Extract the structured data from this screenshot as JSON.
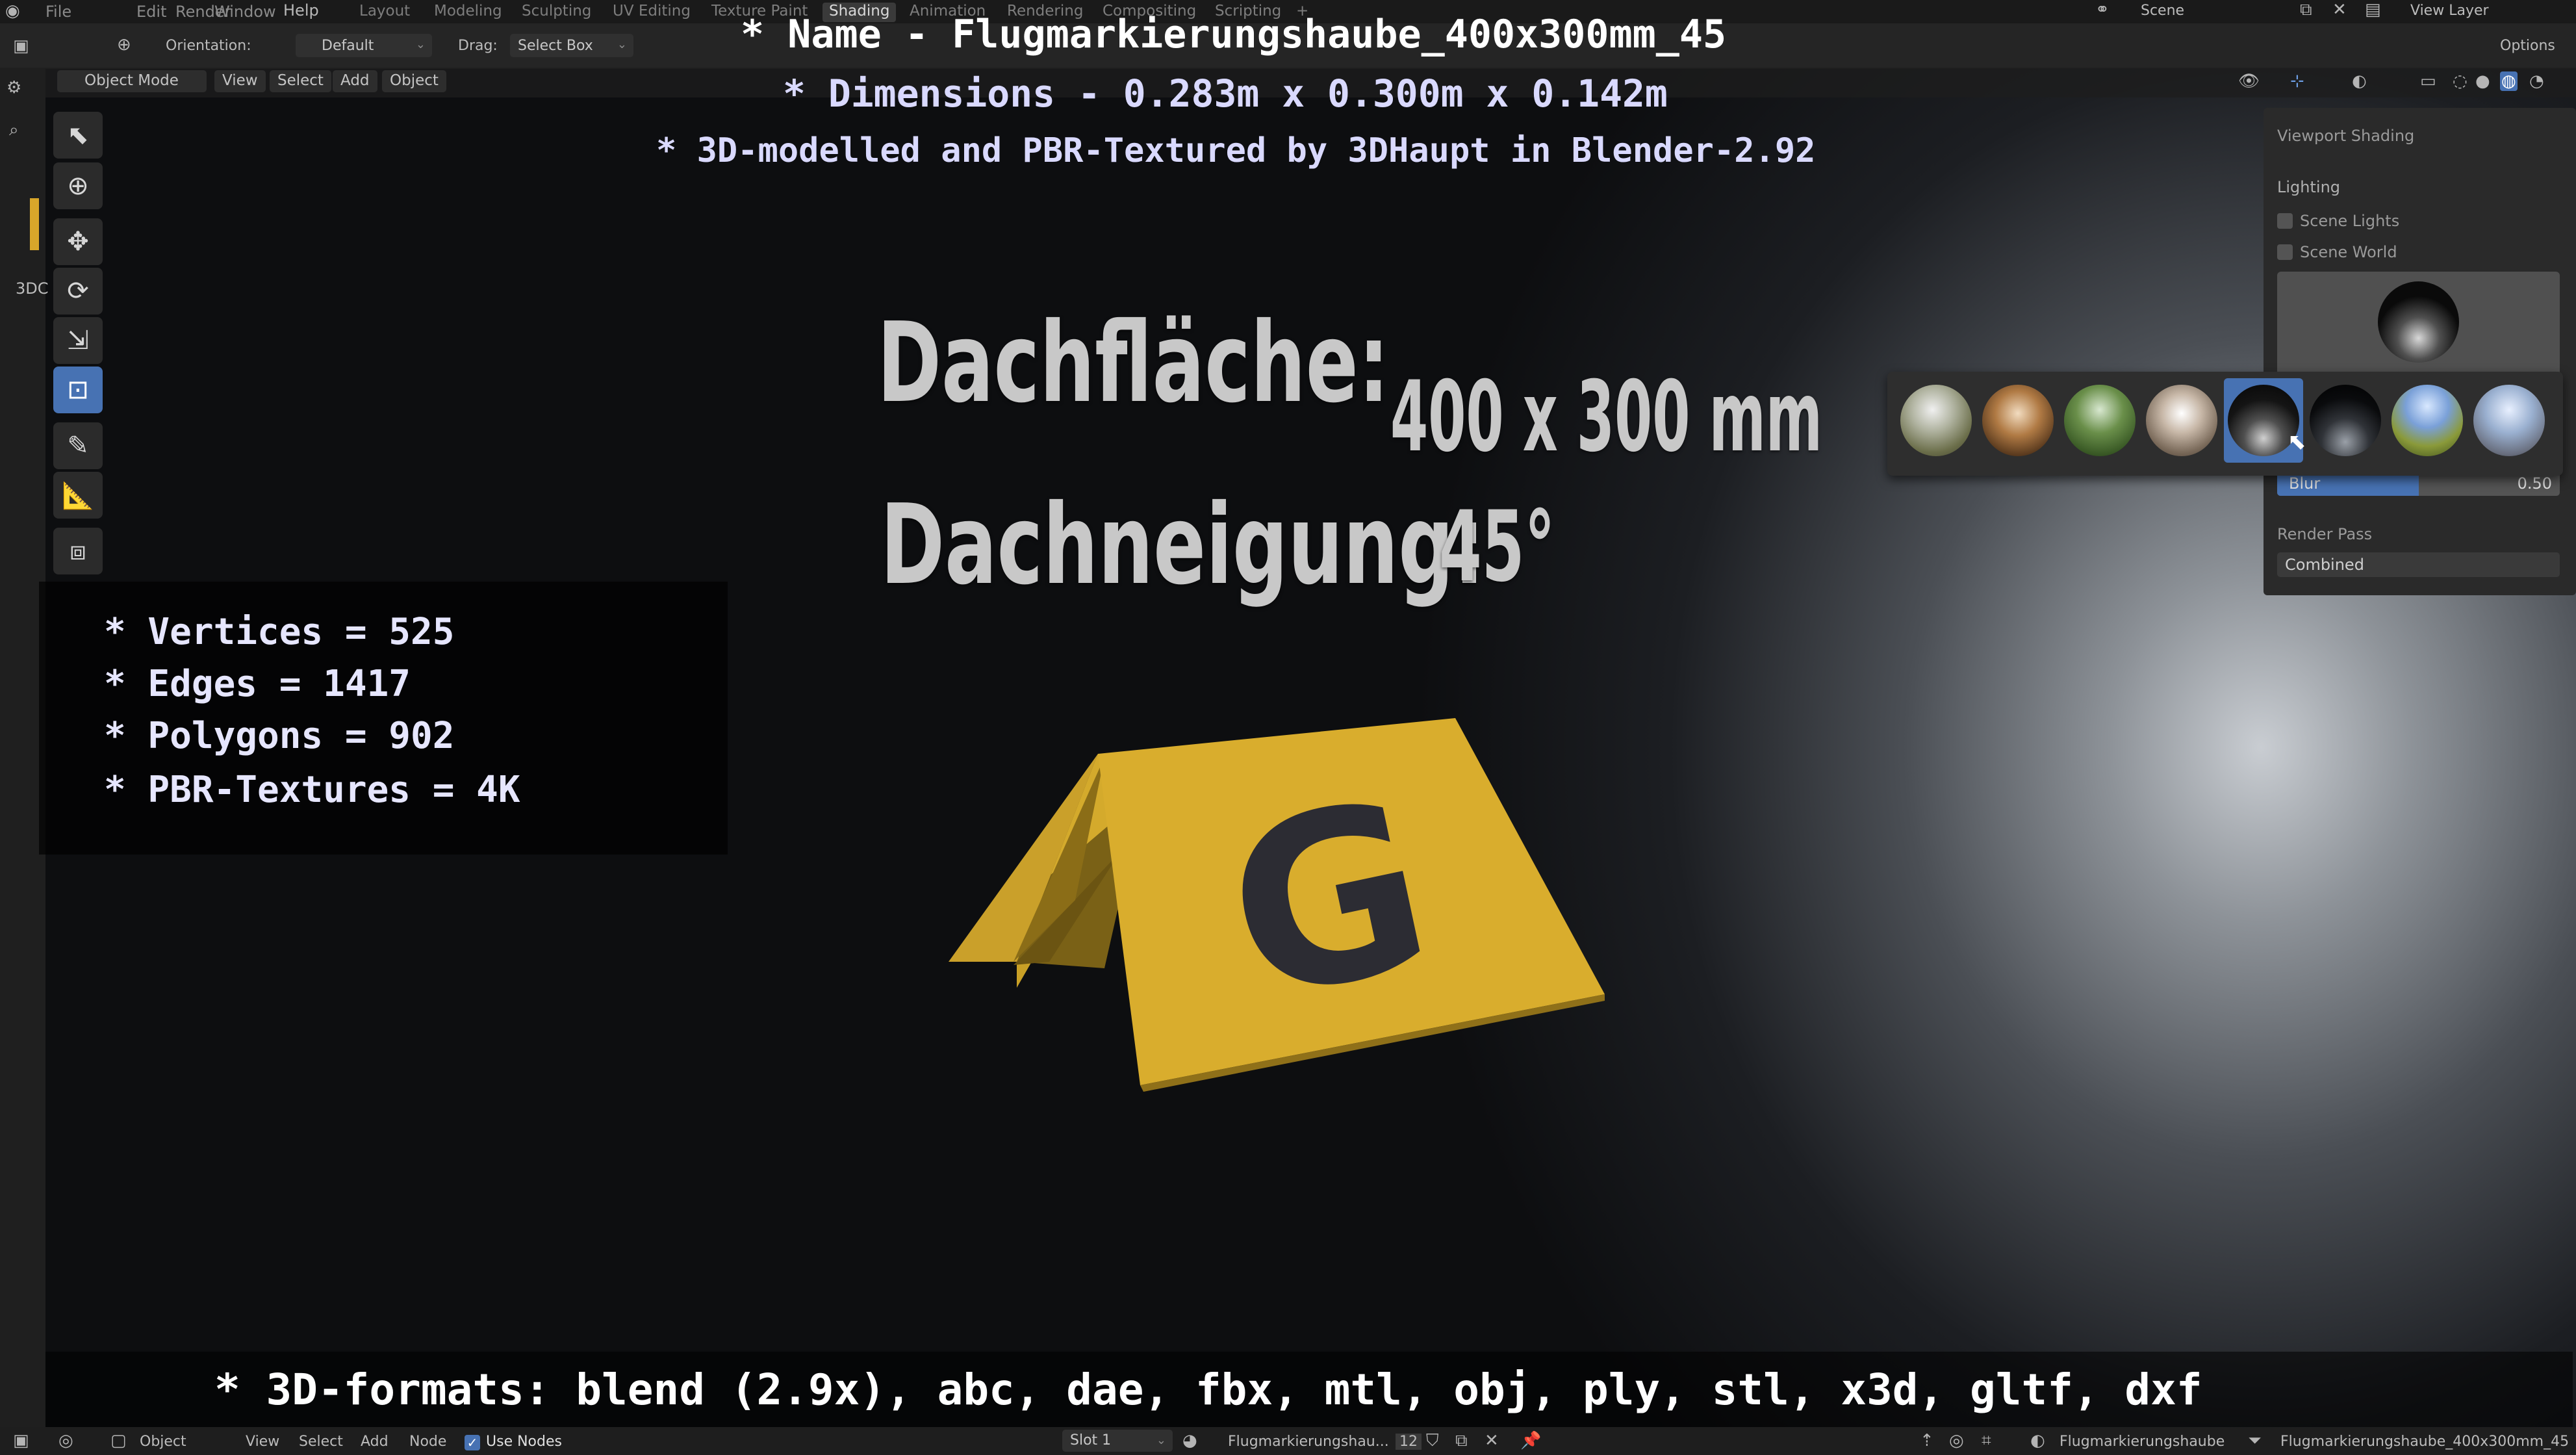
{
  "overlay": {
    "name_line": "* Name - Flugmarkierungshaube_400x300mm_45",
    "dimensions_line": "* Dimensions -  0.283m x 0.300m x 0.142m",
    "credit_line": "* 3D-modelled and PBR-Textured by 3DHaupt in Blender-2.92",
    "stats": [
      "* Vertices = 525",
      "* Edges = 1417",
      "* Polygons = 902",
      "* PBR-Textures = 4K"
    ],
    "formats_line": "* 3D-formats: blend (2.9x), abc, dae, fbx, mtl, obj, ply, stl, x3d, gltf, dxf"
  },
  "scene_text": {
    "roof_area": "Dachfläche:",
    "roof_area_value": "400 x 300 mm",
    "roof_pitch": "Dachneigung:",
    "roof_pitch_value": "45°",
    "marker_letter": "G"
  },
  "topbar": {
    "menu": [
      "File",
      "Edit",
      "Render",
      "Window",
      "Help"
    ],
    "workspaces": [
      "Layout",
      "Modeling",
      "Sculpting",
      "UV Editing",
      "Texture Paint",
      "Shading",
      "Animation",
      "Rendering",
      "Compositing",
      "Scripting",
      "+"
    ],
    "active_workspace": "Shading",
    "scene_label": "Scene",
    "view_layer_label": "View Layer"
  },
  "tool_header": {
    "orientation_label": "Orientation:",
    "orientation_value": "Default",
    "drag_label": "Drag:",
    "drag_value": "Select Box",
    "options_label": "Options"
  },
  "viewport_header": {
    "mode": "Object Mode",
    "menus": [
      "View",
      "Select",
      "Add",
      "Object"
    ]
  },
  "editor_label": "3DC",
  "viewport_shading_panel": {
    "title": "Viewport Shading",
    "lighting_label": "Lighting",
    "scene_lights_label": "Scene Lights",
    "scene_world_label": "Scene World",
    "blur_label": "Blur",
    "blur_value": "0.50",
    "blur_fraction": 0.5,
    "render_pass_label": "Render Pass",
    "render_pass_value": "Combined"
  },
  "hdri_popup": {
    "count": 8,
    "selected_index": 4
  },
  "status_bar": {
    "object_label": "Object",
    "menus": [
      "View",
      "Select",
      "Add",
      "Node"
    ],
    "use_nodes_label": "Use Nodes",
    "slot_label": "Slot 1",
    "material_name": "Flugmarkierungshau...",
    "user_count": "12",
    "object_name": "Flugmarkierungshaube",
    "mesh_name": "Flugmarkierungshaube_400x300mm_45"
  },
  "colors": {
    "accent_blue": "#4772b3",
    "marker_yellow": "#e3b52f",
    "overlay_text_lavender": "#d9d9ff"
  }
}
